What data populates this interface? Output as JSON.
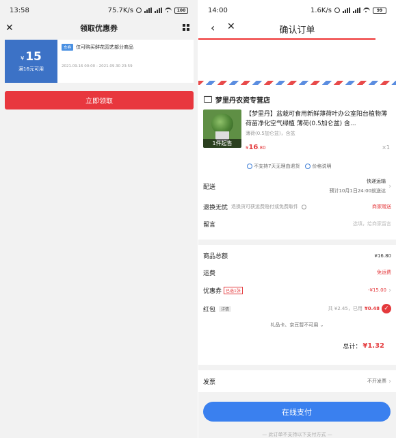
{
  "left": {
    "status": {
      "time": "13:58",
      "speed": "75.7K/s",
      "battery": "100"
    },
    "title": "领取优惠券",
    "coupon": {
      "currency": "¥",
      "amount": "15",
      "condition": "满16元可用",
      "tag": "东券",
      "description": "仅可购买鲜花园艺部分商品",
      "validity": "2021.09.16 00:00 - 2021.09.30 23:59"
    },
    "claim_button": "立即领取"
  },
  "right": {
    "status": {
      "time": "14:00",
      "speed": "1.6K/s",
      "battery": "99"
    },
    "title": "确认订单",
    "shop": {
      "name": "梦里丹农资专营店"
    },
    "product": {
      "thumb_label": "1件起售",
      "title": "【梦里丹】盆栽可食用新鲜薄荷叶办公室阳台植物薄荷苗净化空气绿植 薄荷(0.5加仑盆) 含...",
      "spec": "薄荷(0.5加仑盆)，含盆",
      "price_symbol": "¥",
      "price_int": "16",
      "price_dec": ".80",
      "qty": "×1"
    },
    "notices": {
      "no_return": "不支持7天无理由退货",
      "price_info": "价格说明"
    },
    "delivery": {
      "label": "配送",
      "method": "快递运输",
      "eta": "预计10月1日24:00前送达"
    },
    "return_service": {
      "label": "退换无忧",
      "desc": "退换货可获运费赔付或免费取件",
      "value": "商家赠送"
    },
    "message": {
      "label": "留言",
      "placeholder": "选填，给商家留言"
    },
    "totals": {
      "goods_label": "商品总额",
      "goods_value": "¥16.80",
      "freight_label": "运费",
      "freight_value": "免运费",
      "coupon_label": "优惠券",
      "coupon_badge": "已选1张",
      "coupon_value": "-¥15.00",
      "redpacket_label": "红包",
      "redpacket_detail": "详情",
      "redpacket_info": "共 ¥2.45，已用",
      "redpacket_used": "¥0.48",
      "giftcard_note": "礼品卡、京豆暂不可用",
      "total_label": "总计：",
      "total_value": "¥1.32"
    },
    "invoice": {
      "label": "发票",
      "value": "不开发票"
    },
    "pay_button": "在线支付",
    "footer_note": "— 此订单不支持以下支付方式 —"
  }
}
